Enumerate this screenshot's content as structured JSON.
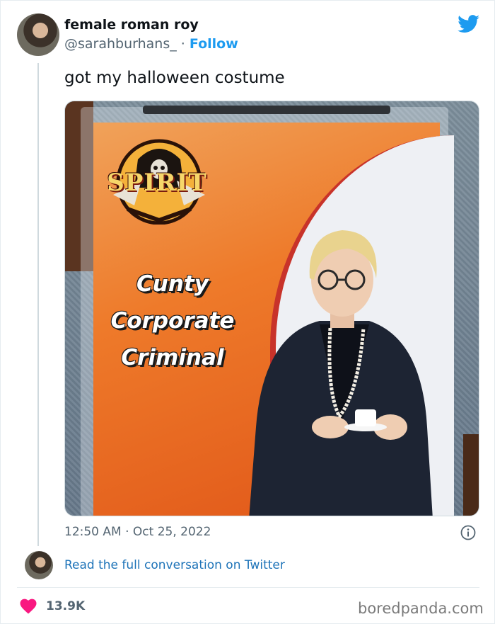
{
  "author": {
    "display_name": "female roman roy",
    "handle": "@sarahburhans_",
    "separator": "·",
    "follow_label": "Follow"
  },
  "tweet": {
    "text": "got my halloween costume",
    "timestamp": "12:50 AM · Oct 25, 2022"
  },
  "photo": {
    "brand_logo_text": "SPIRIT",
    "costume_title_lines": [
      "Cunty",
      "Corporate",
      "Criminal"
    ]
  },
  "footer": {
    "read_link": "Read the full conversation on Twitter",
    "likes": "13.9K",
    "watermark": "boredpanda.com"
  },
  "icons": {
    "brand": "twitter-bird-icon",
    "info": "info-icon",
    "like": "heart-icon"
  },
  "colors": {
    "link": "#1d9bf0",
    "like": "#f91880",
    "secondary_text": "#536471",
    "package_orange": "#ee7a2a"
  }
}
